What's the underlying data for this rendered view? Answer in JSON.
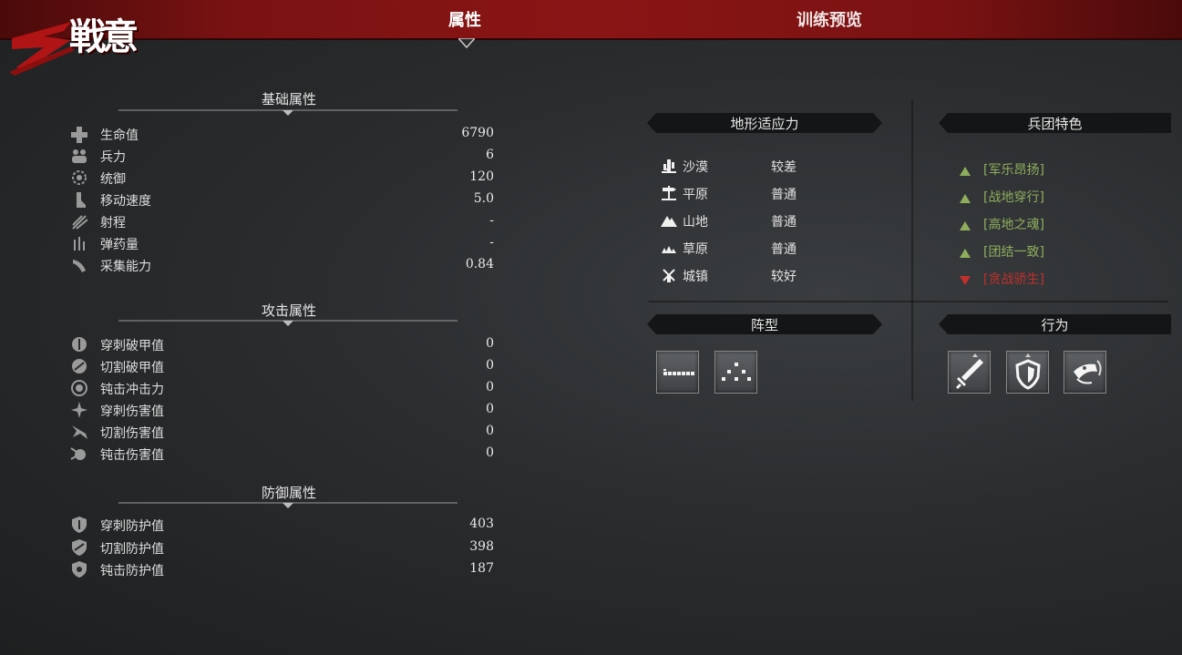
{
  "logo": {
    "text": "戦意"
  },
  "tabs": [
    {
      "label": "属性",
      "active": true
    },
    {
      "label": "训练预览",
      "active": false
    }
  ],
  "basic": {
    "title": "基础属性",
    "rows": [
      {
        "icon": "health-cross-icon",
        "label": "生命值",
        "value": "6790"
      },
      {
        "icon": "troops-icon",
        "label": "兵力",
        "value": "6"
      },
      {
        "icon": "leadership-icon",
        "label": "统御",
        "value": "120"
      },
      {
        "icon": "boot-speed-icon",
        "label": "移动速度",
        "value": "5.0"
      },
      {
        "icon": "range-arrows-icon",
        "label": "射程",
        "value": "-"
      },
      {
        "icon": "ammo-icon",
        "label": "弹药量",
        "value": "-"
      },
      {
        "icon": "gathering-icon",
        "label": "采集能力",
        "value": "0.84"
      }
    ]
  },
  "attack": {
    "title": "攻击属性",
    "rows": [
      {
        "icon": "pierce-armor-break-icon",
        "label": "穿刺破甲值",
        "value": "0"
      },
      {
        "icon": "slash-armor-break-icon",
        "label": "切割破甲值",
        "value": "0"
      },
      {
        "icon": "blunt-impact-icon",
        "label": "钝击冲击力",
        "value": "0"
      },
      {
        "icon": "pierce-damage-icon",
        "label": "穿刺伤害值",
        "value": "0"
      },
      {
        "icon": "slash-damage-icon",
        "label": "切割伤害值",
        "value": "0"
      },
      {
        "icon": "blunt-damage-icon",
        "label": "钝击伤害值",
        "value": "0"
      }
    ]
  },
  "defense": {
    "title": "防御属性",
    "rows": [
      {
        "icon": "pierce-shield-icon",
        "label": "穿刺防护值",
        "value": "403"
      },
      {
        "icon": "slash-shield-icon",
        "label": "切割防护值",
        "value": "398"
      },
      {
        "icon": "blunt-shield-icon",
        "label": "钝击防护值",
        "value": "187"
      }
    ]
  },
  "terrain": {
    "title": "地形适应力",
    "rows": [
      {
        "icon": "desert-cactus-icon",
        "label": "沙漠",
        "value": "较差"
      },
      {
        "icon": "plain-signpost-icon",
        "label": "平原",
        "value": "普通"
      },
      {
        "icon": "mountain-icon",
        "label": "山地",
        "value": "普通"
      },
      {
        "icon": "grassland-icon",
        "label": "草原",
        "value": "普通"
      },
      {
        "icon": "town-windmill-icon",
        "label": "城镇",
        "value": "较好"
      }
    ]
  },
  "traits": {
    "title": "兵团特色",
    "items": [
      {
        "label": "[军乐昂扬]",
        "positive": true
      },
      {
        "label": "[战地穿行]",
        "positive": true
      },
      {
        "label": "[高地之魂]",
        "positive": true
      },
      {
        "label": "[团结一致]",
        "positive": true
      },
      {
        "label": "[贪战骄生]",
        "positive": false
      }
    ],
    "colors": {
      "positive": "#8fae5c",
      "negative": "#c2302c"
    }
  },
  "formation": {
    "title": "阵型",
    "items": [
      {
        "icon": "line-formation-icon"
      },
      {
        "icon": "loose-formation-icon"
      }
    ]
  },
  "behavior": {
    "title": "行为",
    "items": [
      {
        "icon": "sword-attack-icon"
      },
      {
        "icon": "shield-defend-icon"
      },
      {
        "icon": "horn-rally-icon"
      }
    ]
  }
}
